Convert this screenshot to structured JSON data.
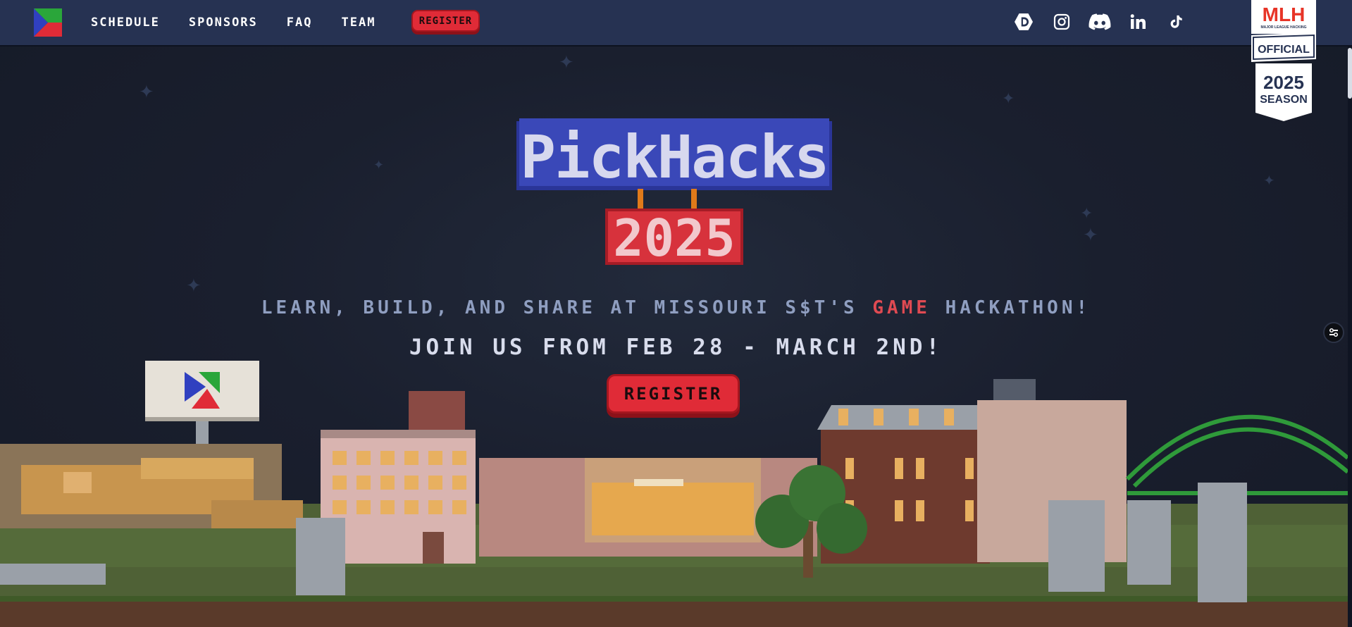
{
  "nav": {
    "links": [
      "SCHEDULE",
      "SPONSORS",
      "FAQ",
      "TEAM"
    ],
    "register_label": "REGISTER",
    "socials": [
      "devpost-icon",
      "instagram-icon",
      "discord-icon",
      "linkedin-icon",
      "tiktok-icon"
    ]
  },
  "mlh_badge": {
    "brand": "MLH",
    "brand_sub": "MAJOR LEAGUE HACKING",
    "official": "OFFICIAL",
    "year": "2025",
    "season": "SEASON"
  },
  "hero": {
    "title": "PickHacks",
    "year": "2025",
    "tagline_before": "LEARN, BUILD, AND SHARE AT MISSOURI S$T'S",
    "tagline_highlight": "GAME",
    "tagline_after": "HACKATHON!",
    "dates": "JOIN US FROM FEB 28 - MARCH 2ND!",
    "register_label": "REGISTER"
  },
  "colors": {
    "nav_bg": "#263252",
    "sky": "#1a1f2e",
    "accent_red": "#e02b37",
    "tagline": "#8f9ec0",
    "highlight": "#e04a52",
    "title_blue": "#3a48b8"
  }
}
